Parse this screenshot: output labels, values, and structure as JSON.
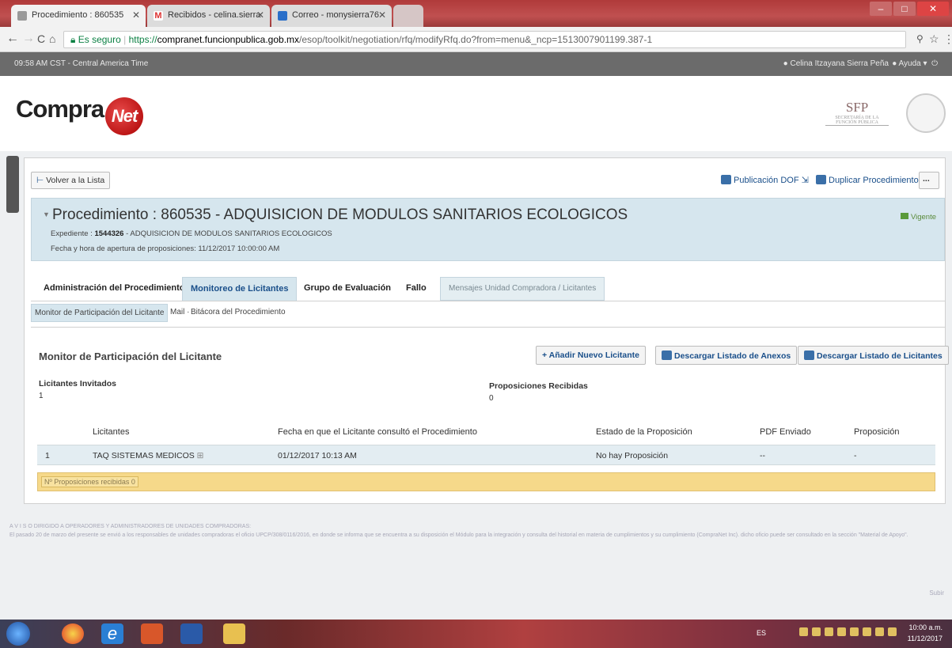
{
  "browser": {
    "tabs": [
      {
        "title": "Procedimiento : 860535",
        "active": true
      },
      {
        "title": "Recibidos - celina.sierra",
        "active": false
      },
      {
        "title": "Correo - monysierra76",
        "active": false
      }
    ],
    "secure_label": "Es seguro",
    "url_proto": "https://",
    "url_host": "compranet.funcionpublica.gob.mx",
    "url_path": "/esop/toolkit/negotiation/rfq/modifyRfq.do?from=menu&_ncp=1513007901199.387-1"
  },
  "topbar": {
    "time": "09:58 AM CST - Central America Time",
    "user": "Celina Itzayana Sierra Peña",
    "help": "Ayuda"
  },
  "logo": {
    "compra": "Compra",
    "net": "Net",
    "sfp": "SFP",
    "sfp_sub": "SECRETARÍA DE LA FUNCIÓN PÚBLICA"
  },
  "actions": {
    "back": "Volver a la Lista",
    "dof": "Publicación DOF",
    "duplicate": "Duplicar Procedimiento",
    "more": "..."
  },
  "procedure": {
    "title": "Procedimiento : 860535 - ADQUISICION DE MODULOS SANITARIOS ECOLOGICOS",
    "exp_label": "Expediente :",
    "exp_num": "1544326",
    "exp_desc": " - ADQUISICION DE MODULOS SANITARIOS ECOLOGICOS",
    "fecha": "Fecha y hora de apertura de proposiciones: 11/12/2017 10:00:00 AM",
    "status": "Vigente"
  },
  "tabs": [
    "Administración del Procedimiento",
    "Monitoreo de Licitantes",
    "Grupo de Evaluación",
    "Fallo",
    "Mensajes Unidad Compradora / Licitantes"
  ],
  "subtabs": [
    "Monitor de Participación del Licitante",
    "Mail",
    "Bitácora del Procedimiento"
  ],
  "section": {
    "title": "Monitor de Participación del Licitante",
    "add": "+ Añadir Nuevo Licitante",
    "dl_anexos": "Descargar Listado de Anexos",
    "dl_licitantes": "Descargar Listado de Licitantes",
    "invitados_label": "Licitantes Invitados",
    "invitados_val": "1",
    "recibidas_label": "Proposiciones Recibidas",
    "recibidas_val": "0"
  },
  "table": {
    "headers": [
      "Licitantes",
      "Fecha en que el Licitante consultó el Procedimiento",
      "Estado de la Proposición",
      "PDF Enviado",
      "Proposición"
    ],
    "rows": [
      [
        "1",
        "TAQ SISTEMAS MEDICOS",
        "01/12/2017 10:13 AM",
        "No hay Proposición",
        "--",
        "-"
      ]
    ],
    "footer": "Nº Proposiciones recibidas 0"
  },
  "notice": {
    "line1": "A V I S O DIRIGIDO A OPERADORES Y ADMINISTRADORES DE UNIDADES COMPRADORAS:",
    "line2": "El pasado 20 de marzo del presente se envió a los responsables de unidades compradoras el oficio UPCP/308/0116/2016, en donde se informa que se encuentra a su disposición el Módulo para la integración y consulta del historial en materia de cumplimientos y su cumplimiento (CompraNet Inc). dicho oficio puede ser consultado en la sección \"Material de Apoyo\".",
    "subir": "Subir"
  },
  "taskbar": {
    "lang": "ES",
    "time": "10:00 a.m.",
    "date": "11/12/2017"
  }
}
